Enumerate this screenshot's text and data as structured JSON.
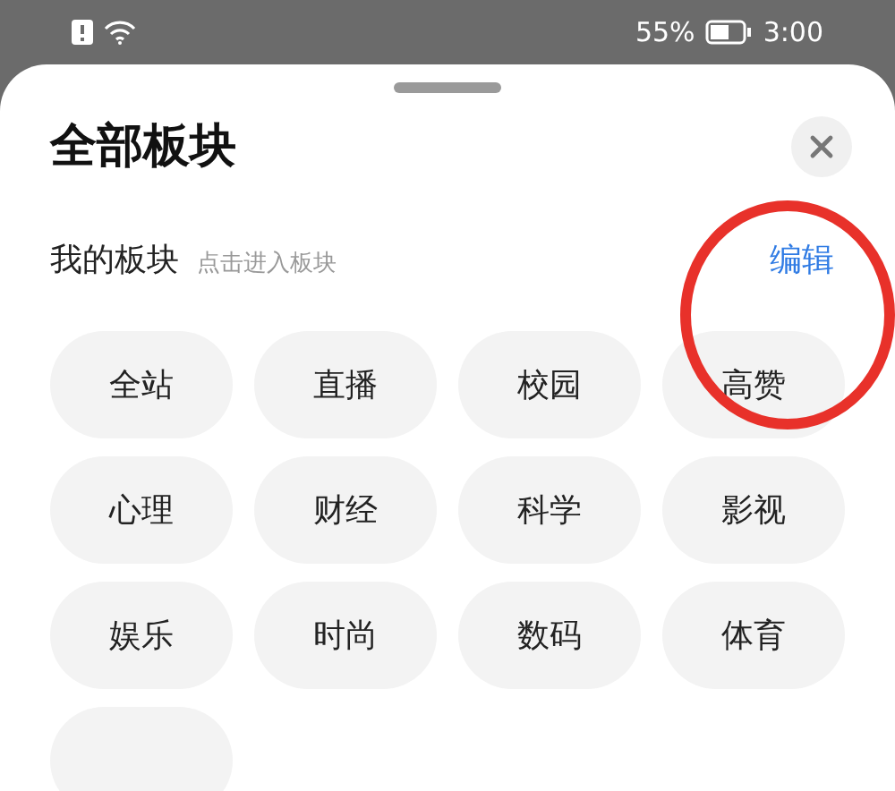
{
  "status_bar": {
    "battery": "55%",
    "time": "3:00"
  },
  "sheet": {
    "title": "全部板块",
    "section": {
      "title": "我的板块",
      "hint": "点击进入板块",
      "action": "编辑"
    },
    "topics": [
      {
        "kind": "labeled",
        "label": "全站"
      },
      {
        "kind": "labeled",
        "label": "直播"
      },
      {
        "kind": "labeled",
        "label": "校园"
      },
      {
        "kind": "labeled",
        "label": "高赞"
      },
      {
        "kind": "labeled",
        "label": "心理"
      },
      {
        "kind": "labeled",
        "label": "财经"
      },
      {
        "kind": "labeled",
        "label": "科学"
      },
      {
        "kind": "labeled",
        "label": "影视"
      },
      {
        "kind": "labeled",
        "label": "娱乐"
      },
      {
        "kind": "labeled",
        "label": "时尚"
      },
      {
        "kind": "labeled",
        "label": "数码"
      },
      {
        "kind": "labeled",
        "label": "体育"
      },
      {
        "kind": "cut_off"
      }
    ]
  }
}
